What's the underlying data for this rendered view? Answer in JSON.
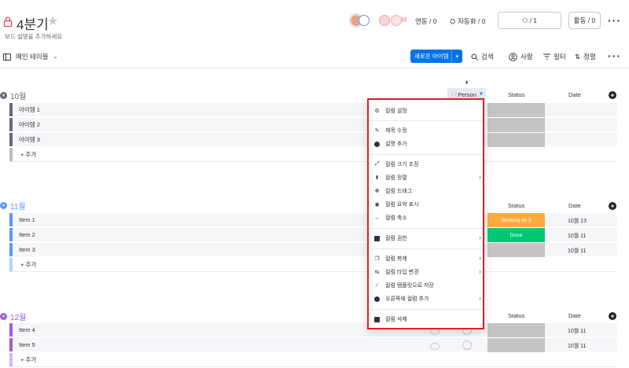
{
  "board": {
    "title": "4분기",
    "subtitle": "보드 설명을 추가하세요"
  },
  "header": {
    "integrations_label": "연동 / 0",
    "automations_label": "자동화 / 0",
    "invite_label": "/ 1",
    "activity_label": "활동 / 0"
  },
  "toolbar": {
    "view_label": "메인 테이블",
    "new_item_label": "새로운 아이템",
    "search_label": "검색",
    "person_label": "사람",
    "filter_label": "필터",
    "sort_label": "정렬"
  },
  "columns": {
    "person": "Person",
    "status": "Status",
    "date": "Date"
  },
  "groups": [
    {
      "title": "10월",
      "color": "#676879",
      "items": [
        "아이템 1",
        "아이템 2",
        "아이템 3"
      ],
      "add_label": "+ 추가"
    },
    {
      "title": "11월",
      "color": "#579bfc",
      "items": [
        "Item 1",
        "Item 2",
        "Item 3"
      ],
      "statuses": [
        "Working on it",
        "Done",
        ""
      ],
      "dates": [
        "10월 13",
        "10월 11",
        "10월 11"
      ],
      "add_label": "+ 추가"
    },
    {
      "title": "12월",
      "color": "#a25ddc",
      "items": [
        "Item 4",
        "Item 5"
      ],
      "dates": [
        "10월 11",
        "10월 11"
      ],
      "add_label": "+ 추가"
    }
  ],
  "status_colors": {
    "working": "#fdab3d",
    "done": "#00c875",
    "empty": "#c4c4c4"
  },
  "menu": {
    "items": [
      {
        "label": "컬럼 설정",
        "icon": "gear-icon"
      },
      {
        "label": "제목 수정",
        "icon": "pencil-icon"
      },
      {
        "label": "설명 추가",
        "icon": "info-icon"
      },
      {
        "label": "컬럼 크기 조정",
        "icon": "resize-icon"
      },
      {
        "label": "컬럼 정렬",
        "icon": "sort-icon"
      },
      {
        "label": "컬럼 드래그",
        "icon": "drag-icon"
      },
      {
        "label": "컬럼 요약 표시",
        "icon": "eye-icon"
      },
      {
        "label": "컬럼 축소",
        "icon": "collapse-icon"
      },
      {
        "label": "컬럼 권한",
        "icon": "lock-icon"
      },
      {
        "label": "컬럼 복제",
        "icon": "duplicate-icon"
      },
      {
        "label": "컬럼 타입 변경",
        "icon": "swap-icon"
      },
      {
        "label": "컬럼 템플릿으로 저장",
        "icon": "wand-icon"
      },
      {
        "label": "오른쪽에 컬럼 추가",
        "icon": "add-circle-icon"
      },
      {
        "label": "컬럼 삭제",
        "icon": "trash-icon"
      }
    ]
  }
}
